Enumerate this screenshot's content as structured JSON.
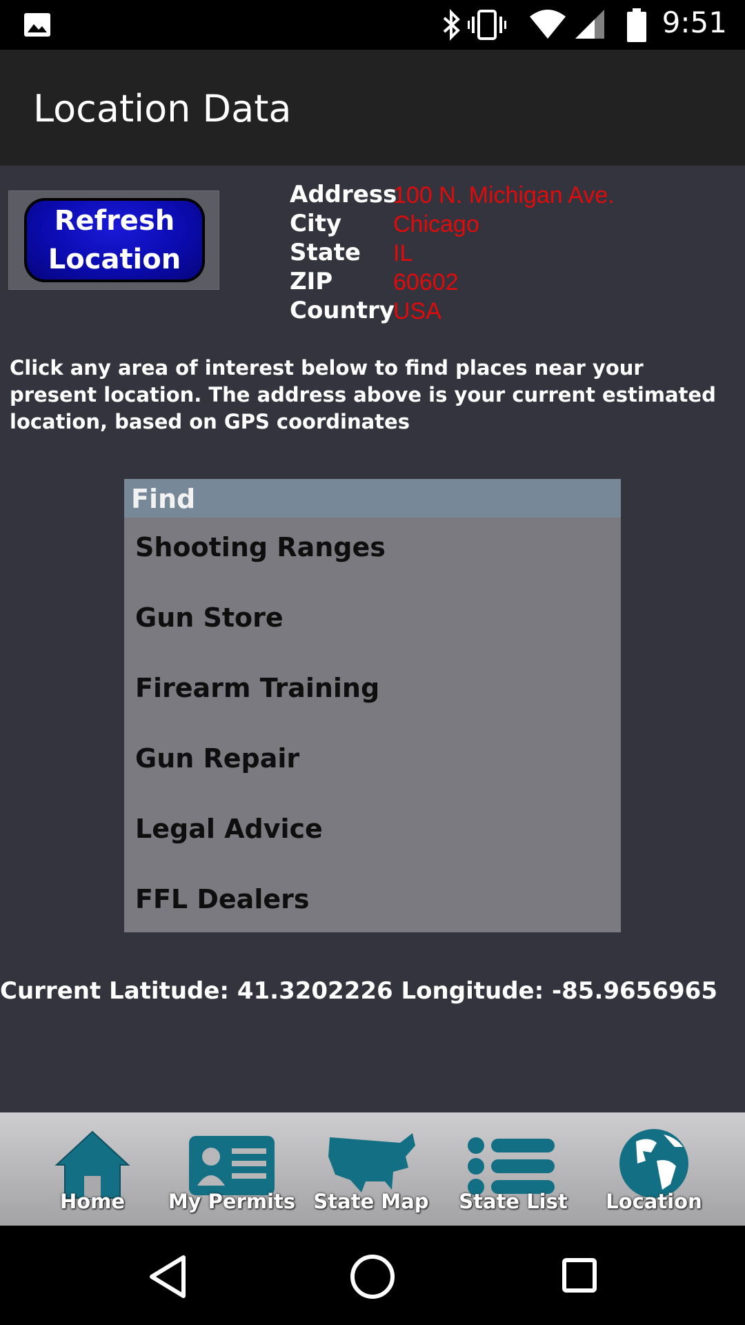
{
  "status_bar": {
    "time": "9:51"
  },
  "app_bar": {
    "title": "Location Data"
  },
  "refresh_button": {
    "line1": "Refresh",
    "line2": "Location"
  },
  "address": [
    {
      "label": "Address",
      "value": "100 N. Michigan Ave."
    },
    {
      "label": "City",
      "value": "Chicago"
    },
    {
      "label": "State",
      "value": "IL"
    },
    {
      "label": "ZIP",
      "value": "60602"
    },
    {
      "label": "Country",
      "value": "USA"
    }
  ],
  "info_text": "Click any area of interest below to find places near your present location.  The address above is your current estimated location, based on GPS coordinates",
  "find": {
    "header": "Find",
    "items": [
      "Shooting Ranges",
      "Gun Store",
      "Firearm Training",
      "Gun Repair",
      "Legal Advice",
      "FFL Dealers"
    ]
  },
  "coordinates_text": "Current Latitude: 41.3202226 Longitude: -85.9656965",
  "tabs": [
    {
      "label": "Home",
      "icon": "home-icon"
    },
    {
      "label": "My Permits",
      "icon": "id-card-icon"
    },
    {
      "label": "State Map",
      "icon": "usa-map-icon"
    },
    {
      "label": "State List",
      "icon": "list-icon"
    },
    {
      "label": "Location",
      "icon": "globe-icon"
    }
  ],
  "colors": {
    "background": "#34343f",
    "address_value": "#e00b0b",
    "tab_icon": "#136f84",
    "find_header": "#778899",
    "refresh_button": "#0b0bb0"
  }
}
